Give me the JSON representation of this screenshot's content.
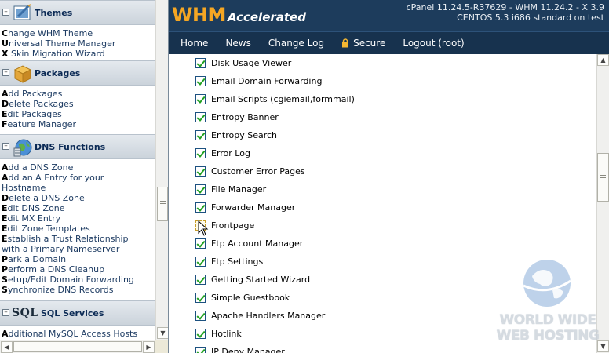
{
  "sidebar": {
    "sections": [
      {
        "title": "Themes",
        "toggle": "⊟",
        "links": [
          {
            "first": "C",
            "rest": "hange WHM Theme"
          },
          {
            "first": "U",
            "rest": "niversal Theme Manager"
          },
          {
            "first": "X",
            "rest": " Skin Migration Wizard"
          }
        ]
      },
      {
        "title": "Packages",
        "toggle": "⊟",
        "links": [
          {
            "first": "A",
            "rest": "dd Packages"
          },
          {
            "first": "D",
            "rest": "elete Packages"
          },
          {
            "first": "E",
            "rest": "dit Packages"
          },
          {
            "first": "F",
            "rest": "eature Manager"
          }
        ]
      },
      {
        "title": "DNS Functions",
        "toggle": "⊟",
        "links": [
          {
            "first": "A",
            "rest": "dd a DNS Zone"
          },
          {
            "first": "A",
            "rest": "dd an A Entry for your"
          },
          {
            "first": "",
            "rest": "Hostname"
          },
          {
            "first": "D",
            "rest": "elete a DNS Zone"
          },
          {
            "first": "E",
            "rest": "dit DNS Zone"
          },
          {
            "first": "E",
            "rest": "dit MX Entry"
          },
          {
            "first": "E",
            "rest": "dit Zone Templates"
          },
          {
            "first": "E",
            "rest": "stablish a Trust Relationship"
          },
          {
            "first": "",
            "rest": "with a Primary Nameserver"
          },
          {
            "first": "P",
            "rest": "ark a Domain"
          },
          {
            "first": "P",
            "rest": "erform a DNS Cleanup"
          },
          {
            "first": "S",
            "rest": "etup/Edit Domain Forwarding"
          },
          {
            "first": "S",
            "rest": "ynchronize DNS Records"
          }
        ]
      },
      {
        "title": "SQL Services",
        "logo": "SQL",
        "toggle": "⊟",
        "links": [
          {
            "first": "A",
            "rest": "dditional MySQL Access Hosts"
          }
        ]
      }
    ]
  },
  "header": {
    "logo_main": "WHM",
    "logo_sub": "Accelerated",
    "version_line1": "cPanel 11.24.5-R37629 - WHM 11.24.2 - X 3.9",
    "version_line2": "CENTOS 5.3 i686 standard on test"
  },
  "nav": {
    "items": [
      "Home",
      "News",
      "Change Log",
      "Secure",
      "Logout (root)"
    ]
  },
  "features": [
    {
      "label": "Disk Usage Viewer",
      "checked": true
    },
    {
      "label": "Email Domain Forwarding",
      "checked": true
    },
    {
      "label": "Email Scripts (cgiemail,formmail)",
      "checked": true
    },
    {
      "label": "Entropy Banner",
      "checked": true
    },
    {
      "label": "Entropy Search",
      "checked": true
    },
    {
      "label": "Error Log",
      "checked": true
    },
    {
      "label": "Customer Error Pages",
      "checked": true
    },
    {
      "label": "File Manager",
      "checked": true
    },
    {
      "label": "Forwarder Manager",
      "checked": true
    },
    {
      "label": "Frontpage",
      "checked": false
    },
    {
      "label": "Ftp Account Manager",
      "checked": true
    },
    {
      "label": "Ftp Settings",
      "checked": true
    },
    {
      "label": "Getting Started Wizard",
      "checked": true
    },
    {
      "label": "Simple Guestbook",
      "checked": true
    },
    {
      "label": "Apache Handlers Manager",
      "checked": true
    },
    {
      "label": "Hotlink",
      "checked": true
    },
    {
      "label": "IP Deny Manager",
      "checked": true
    }
  ],
  "watermark": {
    "line1": "WORLD WIDE",
    "line2": "WEB HOSTING"
  },
  "icons": {
    "themes": "themes-icon",
    "packages": "package-box-icon",
    "dns": "dns-globe-icon",
    "secure": "lock-icon"
  },
  "colors": {
    "header_bg": "#1d3c5c",
    "nav_bg": "#17324e",
    "logo_accent": "#f5a623",
    "checkbox_check": "#21a121"
  }
}
